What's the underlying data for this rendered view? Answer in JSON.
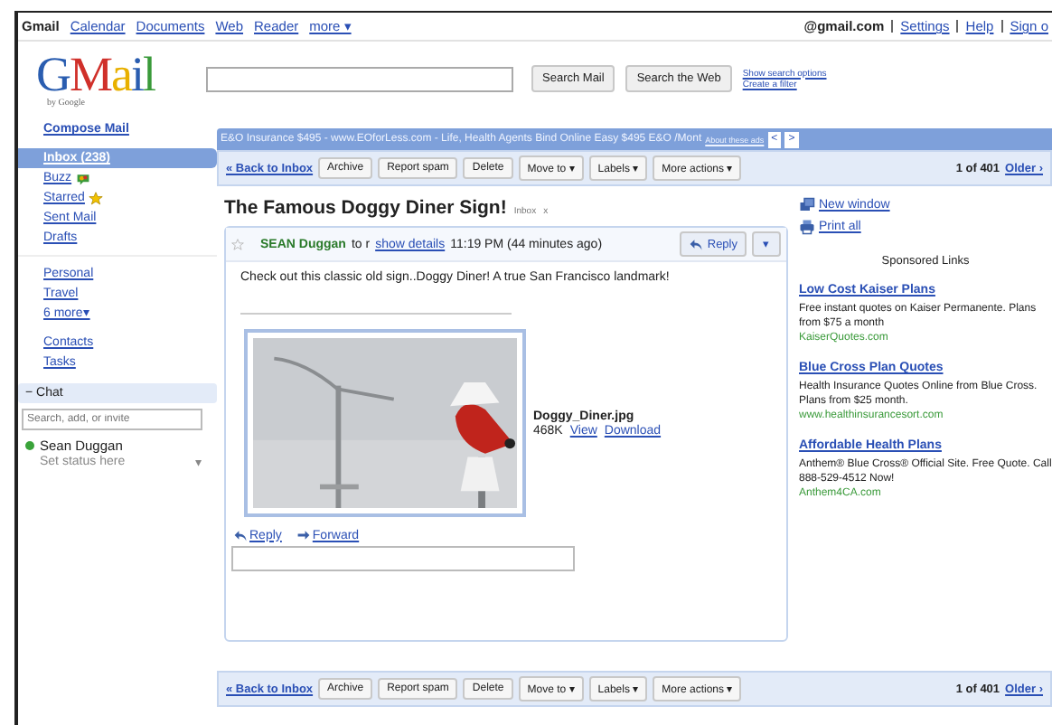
{
  "topnav": {
    "brand": "Gmail",
    "links": [
      "Calendar",
      "Documents",
      "Web",
      "Reader",
      "more ▾"
    ],
    "account": "@gmail.com",
    "account_links": [
      "Settings",
      "Help",
      "Sign o"
    ]
  },
  "logo": {
    "letters": [
      "G",
      "M",
      "a",
      "i",
      "l"
    ],
    "byline": "by Google"
  },
  "search": {
    "buttons": [
      "Search Mail",
      "Search the Web"
    ],
    "links": [
      "Show search options",
      "Create a filter"
    ]
  },
  "sidebar": {
    "compose": "Compose Mail",
    "items": [
      {
        "label": "Inbox (238)",
        "selected": true,
        "kind": "plain"
      },
      {
        "label": "Buzz",
        "selected": false,
        "kind": "buzz"
      },
      {
        "label": "Starred",
        "selected": false,
        "kind": "star"
      },
      {
        "label": "Sent Mail",
        "selected": false,
        "kind": "plain"
      },
      {
        "label": "Drafts",
        "selected": false,
        "kind": "plain"
      }
    ],
    "labels": [
      "Personal",
      "Travel",
      "6 more▾"
    ],
    "extras": [
      "Contacts",
      "Tasks"
    ],
    "chat": {
      "title": "− Chat",
      "placeholder": "Search, add, or invite",
      "contact": "Sean Duggan",
      "status": "Set status here",
      "menu": "▾"
    }
  },
  "ad_bar": {
    "text": "E&O Insurance $495 - www.EOforLess.com - Life, Health Agents Bind Online Easy $495 E&O /Mont",
    "about": "About these ads",
    "prev": "<",
    "next": ">"
  },
  "toolbars": [
    {
      "back": "« Back to Inbox",
      "buttons": [
        "Archive",
        "Report spam",
        "Delete",
        "Move to ▾",
        "Labels ▾",
        "More actions ▾"
      ],
      "count": "1 of 401",
      "older": "Older ›"
    },
    {
      "back": "« Back to Inbox",
      "buttons": [
        "Archive",
        "Report spam",
        "Delete",
        "Move to ▾",
        "Labels ▾",
        "More actions ▾"
      ],
      "count": "1 of 401",
      "older": "Older ›"
    }
  ],
  "subject": {
    "title": "The Famous Doggy Diner Sign!",
    "label": "Inbox",
    "remove": "x"
  },
  "message": {
    "sender": "SEAN Duggan",
    "to": "to r",
    "details": "show details",
    "time": "11:19 PM (44 minutes ago)",
    "reply": "Reply",
    "menu": "▾",
    "body": "Check out this classic old sign..Doggy Diner! A true San Francisco landmark!",
    "attachment": {
      "kind": "picture",
      "name": "Doggy_Diner.jpg",
      "size": "468K",
      "view": "View",
      "download": "Download"
    },
    "actions": [
      "Reply",
      "Forward"
    ]
  },
  "side": {
    "links": [
      "New window",
      "Print all"
    ],
    "sponsored": "Sponsored Links",
    "ads": [
      {
        "title": "Low Cost Kaiser Plans",
        "text": "Free instant quotes on Kaiser Permanente. Plans from $75 a month",
        "url": "KaiserQuotes.com"
      },
      {
        "title": "Blue Cross Plan Quotes",
        "text": "Health Insurance Quotes Online from Blue Cross. Plans from $25 month.",
        "url": "www.healthinsurancesort.com"
      },
      {
        "title": "Affordable Health Plans",
        "text": "Anthem® Blue Cross® Official Site. Free Quote. Call 888-529-4512 Now!",
        "url": "Anthem4CA.com"
      }
    ]
  }
}
